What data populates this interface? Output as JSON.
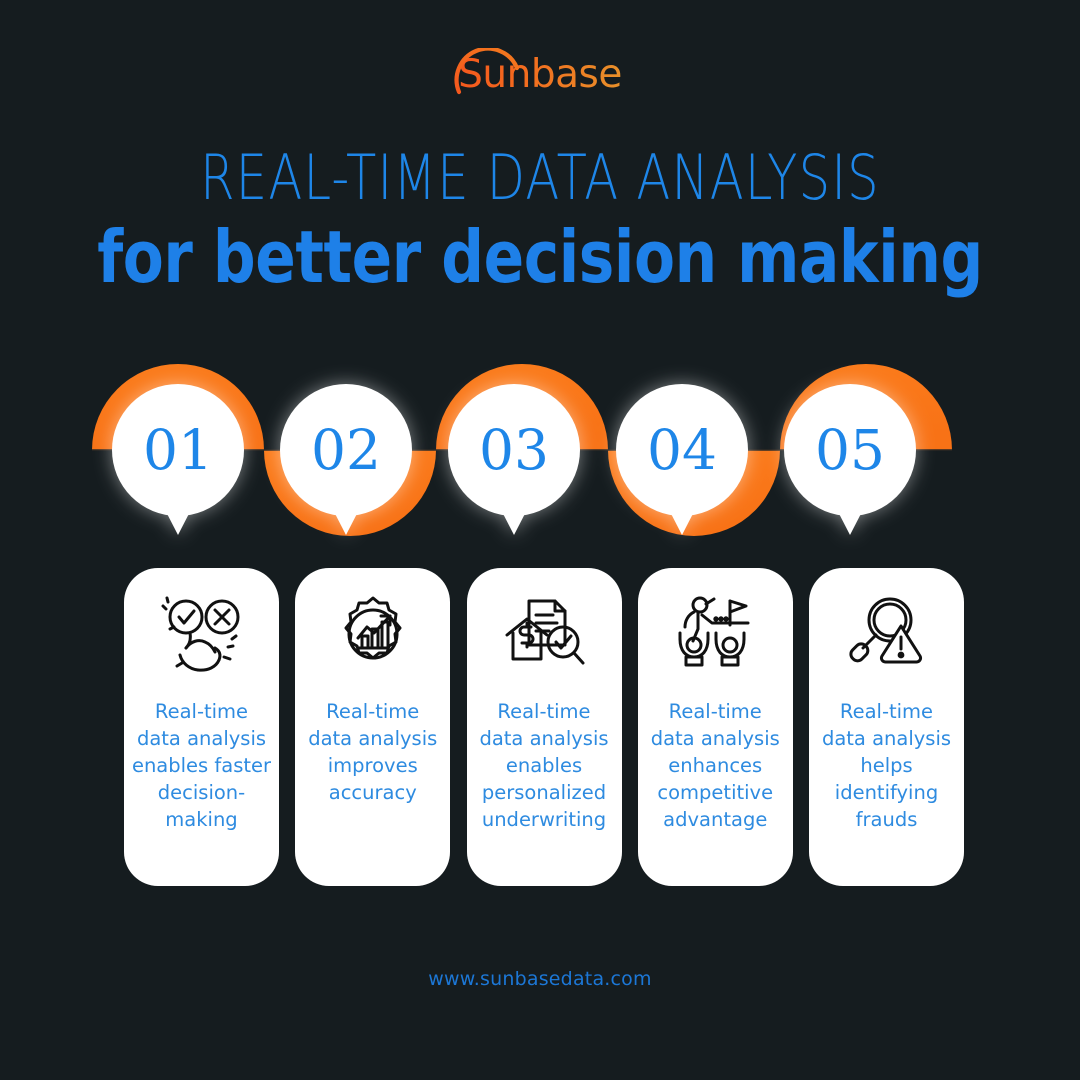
{
  "colors": {
    "background": "#151C1F",
    "orange": "#FA7921",
    "accent_blue": "#1E86E8",
    "card_text_blue": "#2E8BE0",
    "card_bg": "#FFFFFF",
    "icon_stroke": "#111111",
    "logo_orange_start": "#F4581E",
    "logo_orange_end": "#E8912A"
  },
  "brand": {
    "logo_text": "Sunbase",
    "logo_arc_icon": "sun-arc-icon"
  },
  "heading": {
    "line1": "REAL-TIME DATA ANALYSIS",
    "line2": "for better decision making"
  },
  "steps": [
    {
      "number": "01",
      "icon": "decision-hand-check-cross-icon",
      "text": "Real-time data analysis enables faster decision-making"
    },
    {
      "number": "02",
      "icon": "gear-bar-chart-growth-icon",
      "text": "Real-time data analysis improves accuracy"
    },
    {
      "number": "03",
      "icon": "document-house-dollar-magnifier-check-icon",
      "text": "Real-time data analysis enables personalized underwriting"
    },
    {
      "number": "04",
      "icon": "person-climbing-flag-podium-icon",
      "text": "Real-time data analysis enhances competitive advantage"
    },
    {
      "number": "05",
      "icon": "magnifier-warning-triangle-icon",
      "text": "Real-time data analysis helps identifying frauds"
    }
  ],
  "footer": {
    "website": "www.sunbasedata.com"
  }
}
